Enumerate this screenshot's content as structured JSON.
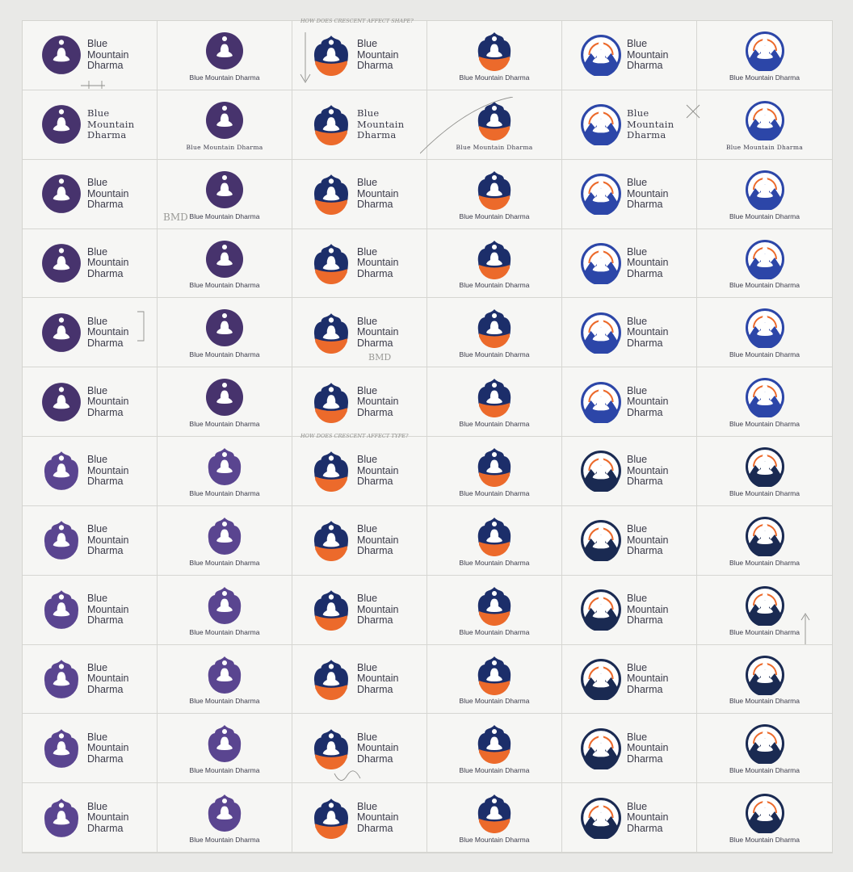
{
  "brand": {
    "name_lines": [
      "Blue",
      "Mountain",
      "Dharma"
    ],
    "name_full": "Blue Mountain Dharma"
  },
  "colors": {
    "purple": "#47336d",
    "purple_light": "#5a4590",
    "navy": "#1c2e6a",
    "orange": "#ec6a2b",
    "blue": "#2c46a8",
    "dark_navy": "#1a2a52",
    "white": "#ffffff"
  },
  "grid": {
    "columns": [
      "purple-horizontal",
      "purple-stacked",
      "flame-orange-horizontal",
      "flame-orange-stacked",
      "mountain-circle-horizontal",
      "mountain-circle-stacked"
    ],
    "rows": 12
  },
  "annotations": {
    "crescent_top": "HOW DOES CRESCENT AFFECT SHAPE?",
    "crescent_mid": "HOW DOES CRESCENT AFFECT TYPE?",
    "bmd_a": "BMD",
    "bmd_b": "BMD"
  }
}
